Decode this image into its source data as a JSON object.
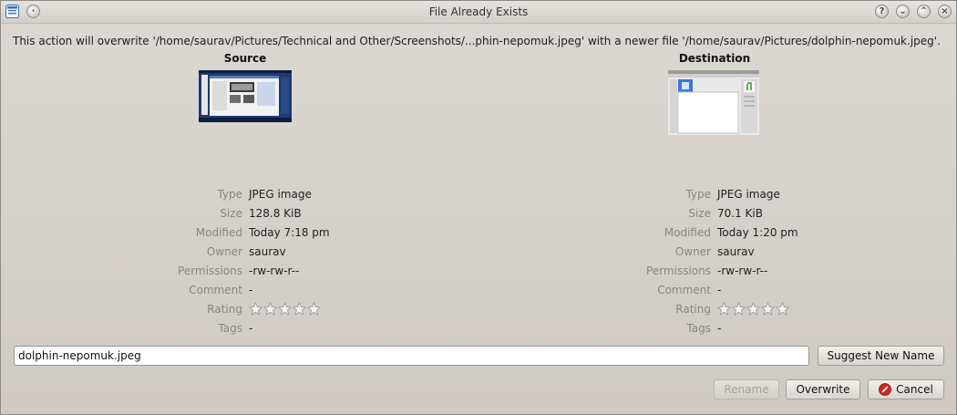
{
  "window": {
    "title": "File Already Exists"
  },
  "message": "This action will overwrite '/home/saurav/Pictures/Technical and Other/Screenshots/...phin-nepomuk.jpeg' with a newer file '/home/saurav/Pictures/dolphin-nepomuk.jpeg'.",
  "source": {
    "heading": "Source",
    "fields": [
      {
        "label": "Type",
        "value": "JPEG image"
      },
      {
        "label": "Size",
        "value": "128.8 KiB"
      },
      {
        "label": "Modified",
        "value": "Today 7:18 pm"
      },
      {
        "label": "Owner",
        "value": "saurav"
      },
      {
        "label": "Permissions",
        "value": "-rw-rw-r--"
      },
      {
        "label": "Comment",
        "value": "-"
      },
      {
        "label": "Rating",
        "stars": 0,
        "max_stars": 5
      },
      {
        "label": "Tags",
        "value": "-"
      }
    ]
  },
  "destination": {
    "heading": "Destination",
    "fields": [
      {
        "label": "Type",
        "value": "JPEG image"
      },
      {
        "label": "Size",
        "value": "70.1 KiB"
      },
      {
        "label": "Modified",
        "value": "Today 1:20 pm"
      },
      {
        "label": "Owner",
        "value": "saurav"
      },
      {
        "label": "Permissions",
        "value": "-rw-rw-r--"
      },
      {
        "label": "Comment",
        "value": "-"
      },
      {
        "label": "Rating",
        "stars": 0,
        "max_stars": 5
      },
      {
        "label": "Tags",
        "value": "-"
      }
    ]
  },
  "rename_field": {
    "value": "dolphin-nepomuk.jpeg"
  },
  "buttons": {
    "suggest": "Suggest New Name",
    "rename": "Rename",
    "overwrite": "Overwrite",
    "cancel": "Cancel"
  },
  "colors": {
    "cancel_icon": "#d02525",
    "thumb_desktop": "#1e3a6e"
  },
  "icons": {
    "app": "dialog-window-icon",
    "title_buttons": [
      "help-icon",
      "minimize-icon",
      "maximize-icon",
      "close-icon"
    ]
  }
}
